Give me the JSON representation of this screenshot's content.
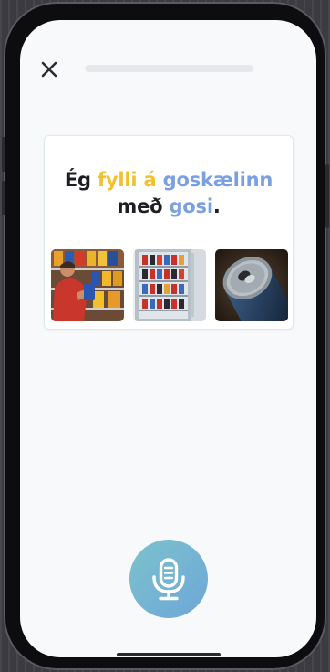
{
  "lesson": {
    "progress_fraction": 0.0,
    "sentence": {
      "parts": [
        {
          "text": "Ég ",
          "style": "plain"
        },
        {
          "text": "fylli á",
          "style": "highlight-yellow"
        },
        {
          "text": " ",
          "style": "plain"
        },
        {
          "text": "goskælinn",
          "style": "highlight-blue"
        },
        {
          "text": "með ",
          "style": "plain"
        },
        {
          "text": "gosi",
          "style": "highlight-blue"
        },
        {
          "text": ".",
          "style": "plain"
        }
      ]
    },
    "pictures": [
      "person stocking chip shelf",
      "open drink refrigerator",
      "soda can"
    ]
  },
  "icons": {
    "close": "close-icon",
    "microphone": "microphone-icon"
  },
  "colors": {
    "highlight_yellow": "#f2c12e",
    "highlight_blue": "#7a9fe2",
    "mic_gradient_start": "#7cc3cc",
    "mic_gradient_end": "#6ea6d8"
  }
}
